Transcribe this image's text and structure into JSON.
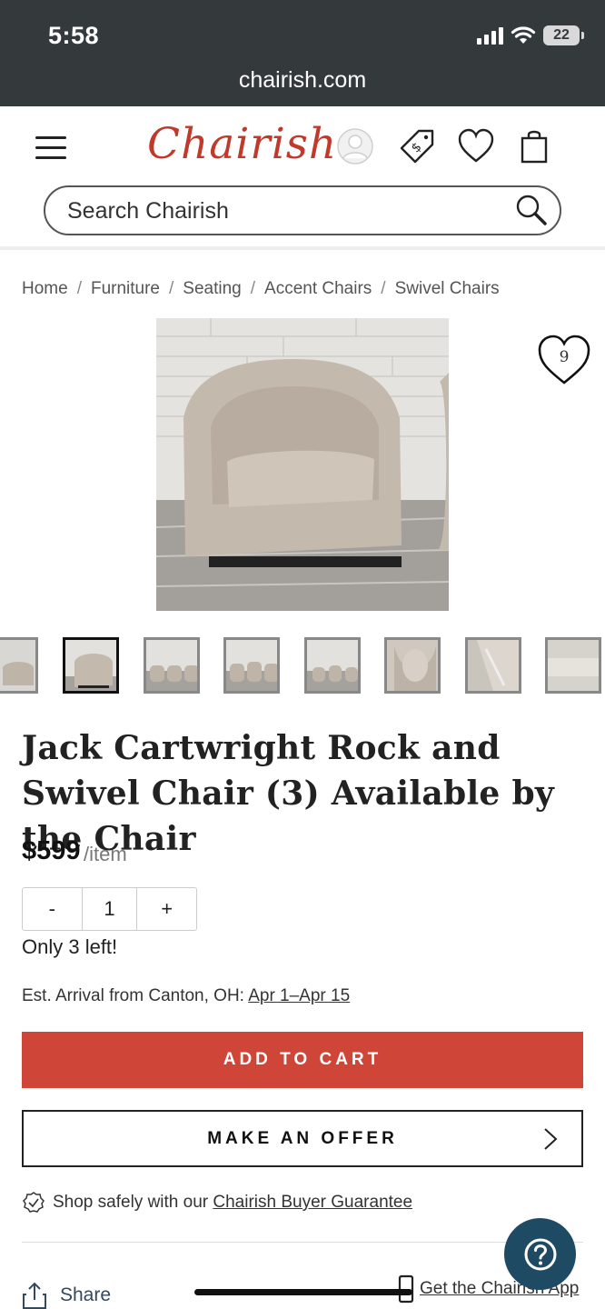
{
  "status_bar": {
    "time": "5:58",
    "battery": "22"
  },
  "browser": {
    "url": "chairish.com"
  },
  "header": {
    "logo": "Chairish",
    "search_placeholder": "Search Chairish"
  },
  "breadcrumb": [
    "Home",
    "Furniture",
    "Seating",
    "Accent Chairs",
    "Swivel Chairs"
  ],
  "favorites": {
    "count": "9"
  },
  "product": {
    "title": "Jack Cartwright Rock and Swivel Chair (3) Available by the Chair",
    "price": "$599",
    "price_unit": "/item",
    "quantity": "1",
    "qty_minus": "-",
    "qty_plus": "+",
    "stock_note": "Only 3 left!",
    "arrival_prefix": "Est. Arrival from Canton, OH: ",
    "arrival_dates": "Apr 1–Apr 15"
  },
  "actions": {
    "add_to_cart": "ADD TO CART",
    "make_offer": "MAKE AN OFFER"
  },
  "guarantee": {
    "prefix": "Shop safely with our ",
    "link": "Chairish Buyer Guarantee"
  },
  "footer": {
    "share": "Share",
    "app_link": "Get the Chairish App"
  },
  "colors": {
    "brand_red": "#c0392b",
    "cart_button": "#cf4538",
    "help_button": "#1f4a63",
    "status_bar": "#34393c"
  }
}
